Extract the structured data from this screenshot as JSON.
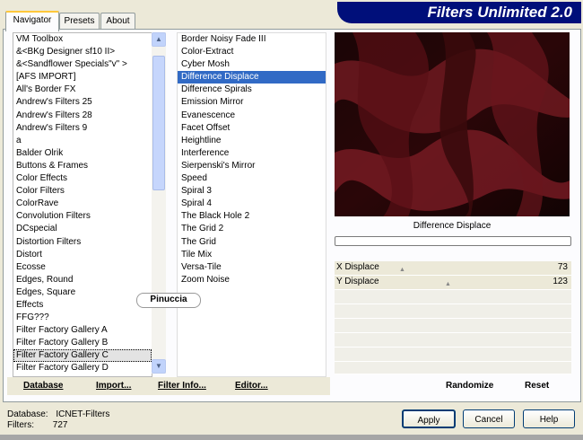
{
  "tabs": [
    "Navigator",
    "Presets",
    "About"
  ],
  "banner": "Filters Unlimited 2.0",
  "categories": [
    "VM Toolbox",
    "&<BKg Designer sf10 II>",
    "&<Sandflower Specials\"v\" >",
    "[AFS IMPORT]",
    "All's Border FX",
    "Andrew's Filters 25",
    "Andrew's Filters 28",
    "Andrew's Filters 9",
    "a",
    "Balder Olrik",
    "Buttons & Frames",
    "Color Effects",
    "Color Filters",
    "ColorRave",
    "Convolution Filters",
    "DCspecial",
    "Distortion Filters",
    "Distort",
    "Ecosse",
    "Edges, Round",
    "Edges, Square",
    "Effects",
    "FFG???",
    "Filter Factory Gallery A",
    "Filter Factory Gallery B",
    "Filter Factory Gallery C",
    "Filter Factory Gallery D"
  ],
  "selected_category": "Filter Factory Gallery C",
  "filters": [
    "Border Noisy Fade III",
    "Color-Extract",
    "Cyber Mosh",
    "Difference Displace",
    "Difference Spirals",
    "Emission Mirror",
    "Evanescence",
    "Facet Offset",
    "Heightline",
    "Interference",
    "Sierpenski's Mirror",
    "Speed",
    "Spiral 3",
    "Spiral 4",
    "The Black Hole 2",
    "The Grid 2",
    "The Grid",
    "Tile Mix",
    "Versa-Tile",
    "Zoom Noise"
  ],
  "selected_filter": "Difference Displace",
  "preview_label": "Difference Displace",
  "params": [
    {
      "name": "X Displace",
      "value": "73"
    },
    {
      "name": "Y Displace",
      "value": "123"
    }
  ],
  "bottom_bar": {
    "database": "Database",
    "import": "Import...",
    "filter_info": "Filter Info...",
    "editor": "Editor...",
    "randomize": "Randomize",
    "reset": "Reset"
  },
  "buttons": {
    "apply": "Apply",
    "cancel": "Cancel",
    "help": "Help"
  },
  "status": {
    "db_label": "Database:",
    "db_value": "ICNET-Filters",
    "filters_label": "Filters:",
    "filters_value": "727"
  },
  "watermark": "Pinuccia",
  "colors": {
    "banner_bg": "#000f7a",
    "selection": "#316ac5",
    "preview_dark": "#1a0506",
    "preview_red": "#7a1a22"
  }
}
